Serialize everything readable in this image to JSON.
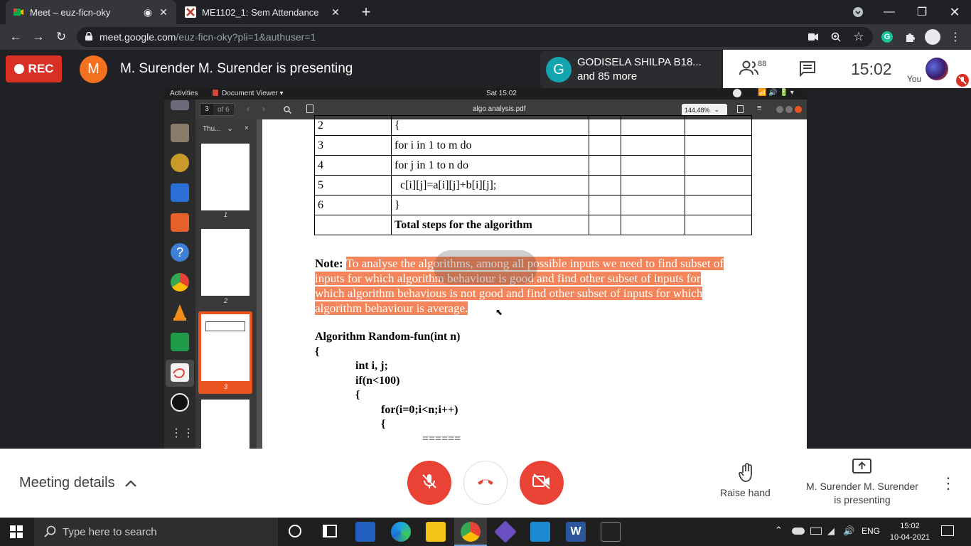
{
  "browser": {
    "tabs": [
      {
        "title": "Meet – euz-ficn-oky",
        "active": true
      },
      {
        "title": "ME1102_1: Sem Attendance",
        "active": false
      }
    ],
    "new_tab": "+",
    "url_host": "meet.google.com",
    "url_path": "/euz-ficn-oky?pli=1&authuser=1"
  },
  "meet": {
    "rec_label": "REC",
    "presenter_initial": "M",
    "presenting_title": "M. Surender M. Surender is presenting",
    "participant_initial": "G",
    "participant_name": "GODISELA SHILPA B18...",
    "participant_more": "and 85 more",
    "people_count": "88",
    "clock": "15:02",
    "you_label": "You",
    "meeting_details": "Meeting details",
    "raise_hand": "Raise hand",
    "presenter_line1": "M. Surender M. Surender",
    "presenter_line2": "is presenting"
  },
  "shared_screen": {
    "ubuntu_activities": "Activities",
    "ubuntu_app": "Document Viewer ▾",
    "ubuntu_time": "Sat 15:02",
    "page_current": "3",
    "page_total": "of 6",
    "doc_title": "algo analysis.pdf",
    "zoom": "144.48%",
    "sidebar_label": "Thu...",
    "thumb_labels": [
      "1",
      "2",
      "3"
    ],
    "table_rows": [
      {
        "step": "2",
        "code": "{"
      },
      {
        "step": "3",
        "code": "for i in 1 to m do"
      },
      {
        "step": "4",
        "code": "for  j in 1 to n do"
      },
      {
        "step": "5",
        "code": "  c[i][j]=a[i][j]+b[i][j];"
      },
      {
        "step": "6",
        "code": "}"
      },
      {
        "step": "",
        "code": "Total steps for the algorithm"
      }
    ],
    "note_label": "Note:",
    "note_lines": [
      "To analyse the algorithms, among all possible inputs we need to find subset of",
      "inputs for which algorithm behaviour is good and find other subset of inputs for",
      "which algorithm behavious is not good and find other subset of inputs for which",
      "algorithm behaviour is average."
    ],
    "code_lines": [
      "Algorithm Random-fun(int n)",
      "{",
      "int i, j;",
      "if(n<100)",
      "{",
      "for(i=0;i<n;i++)",
      "{",
      "======"
    ]
  },
  "taskbar": {
    "search_placeholder": "Type here to search",
    "lang": "ENG",
    "time": "15:02",
    "date": "10-04-2021"
  },
  "colors": {
    "rec_red": "#d93025",
    "highlight": "#f4855a",
    "presenter_orange": "#f4711f",
    "meet_red": "#ea4335"
  }
}
